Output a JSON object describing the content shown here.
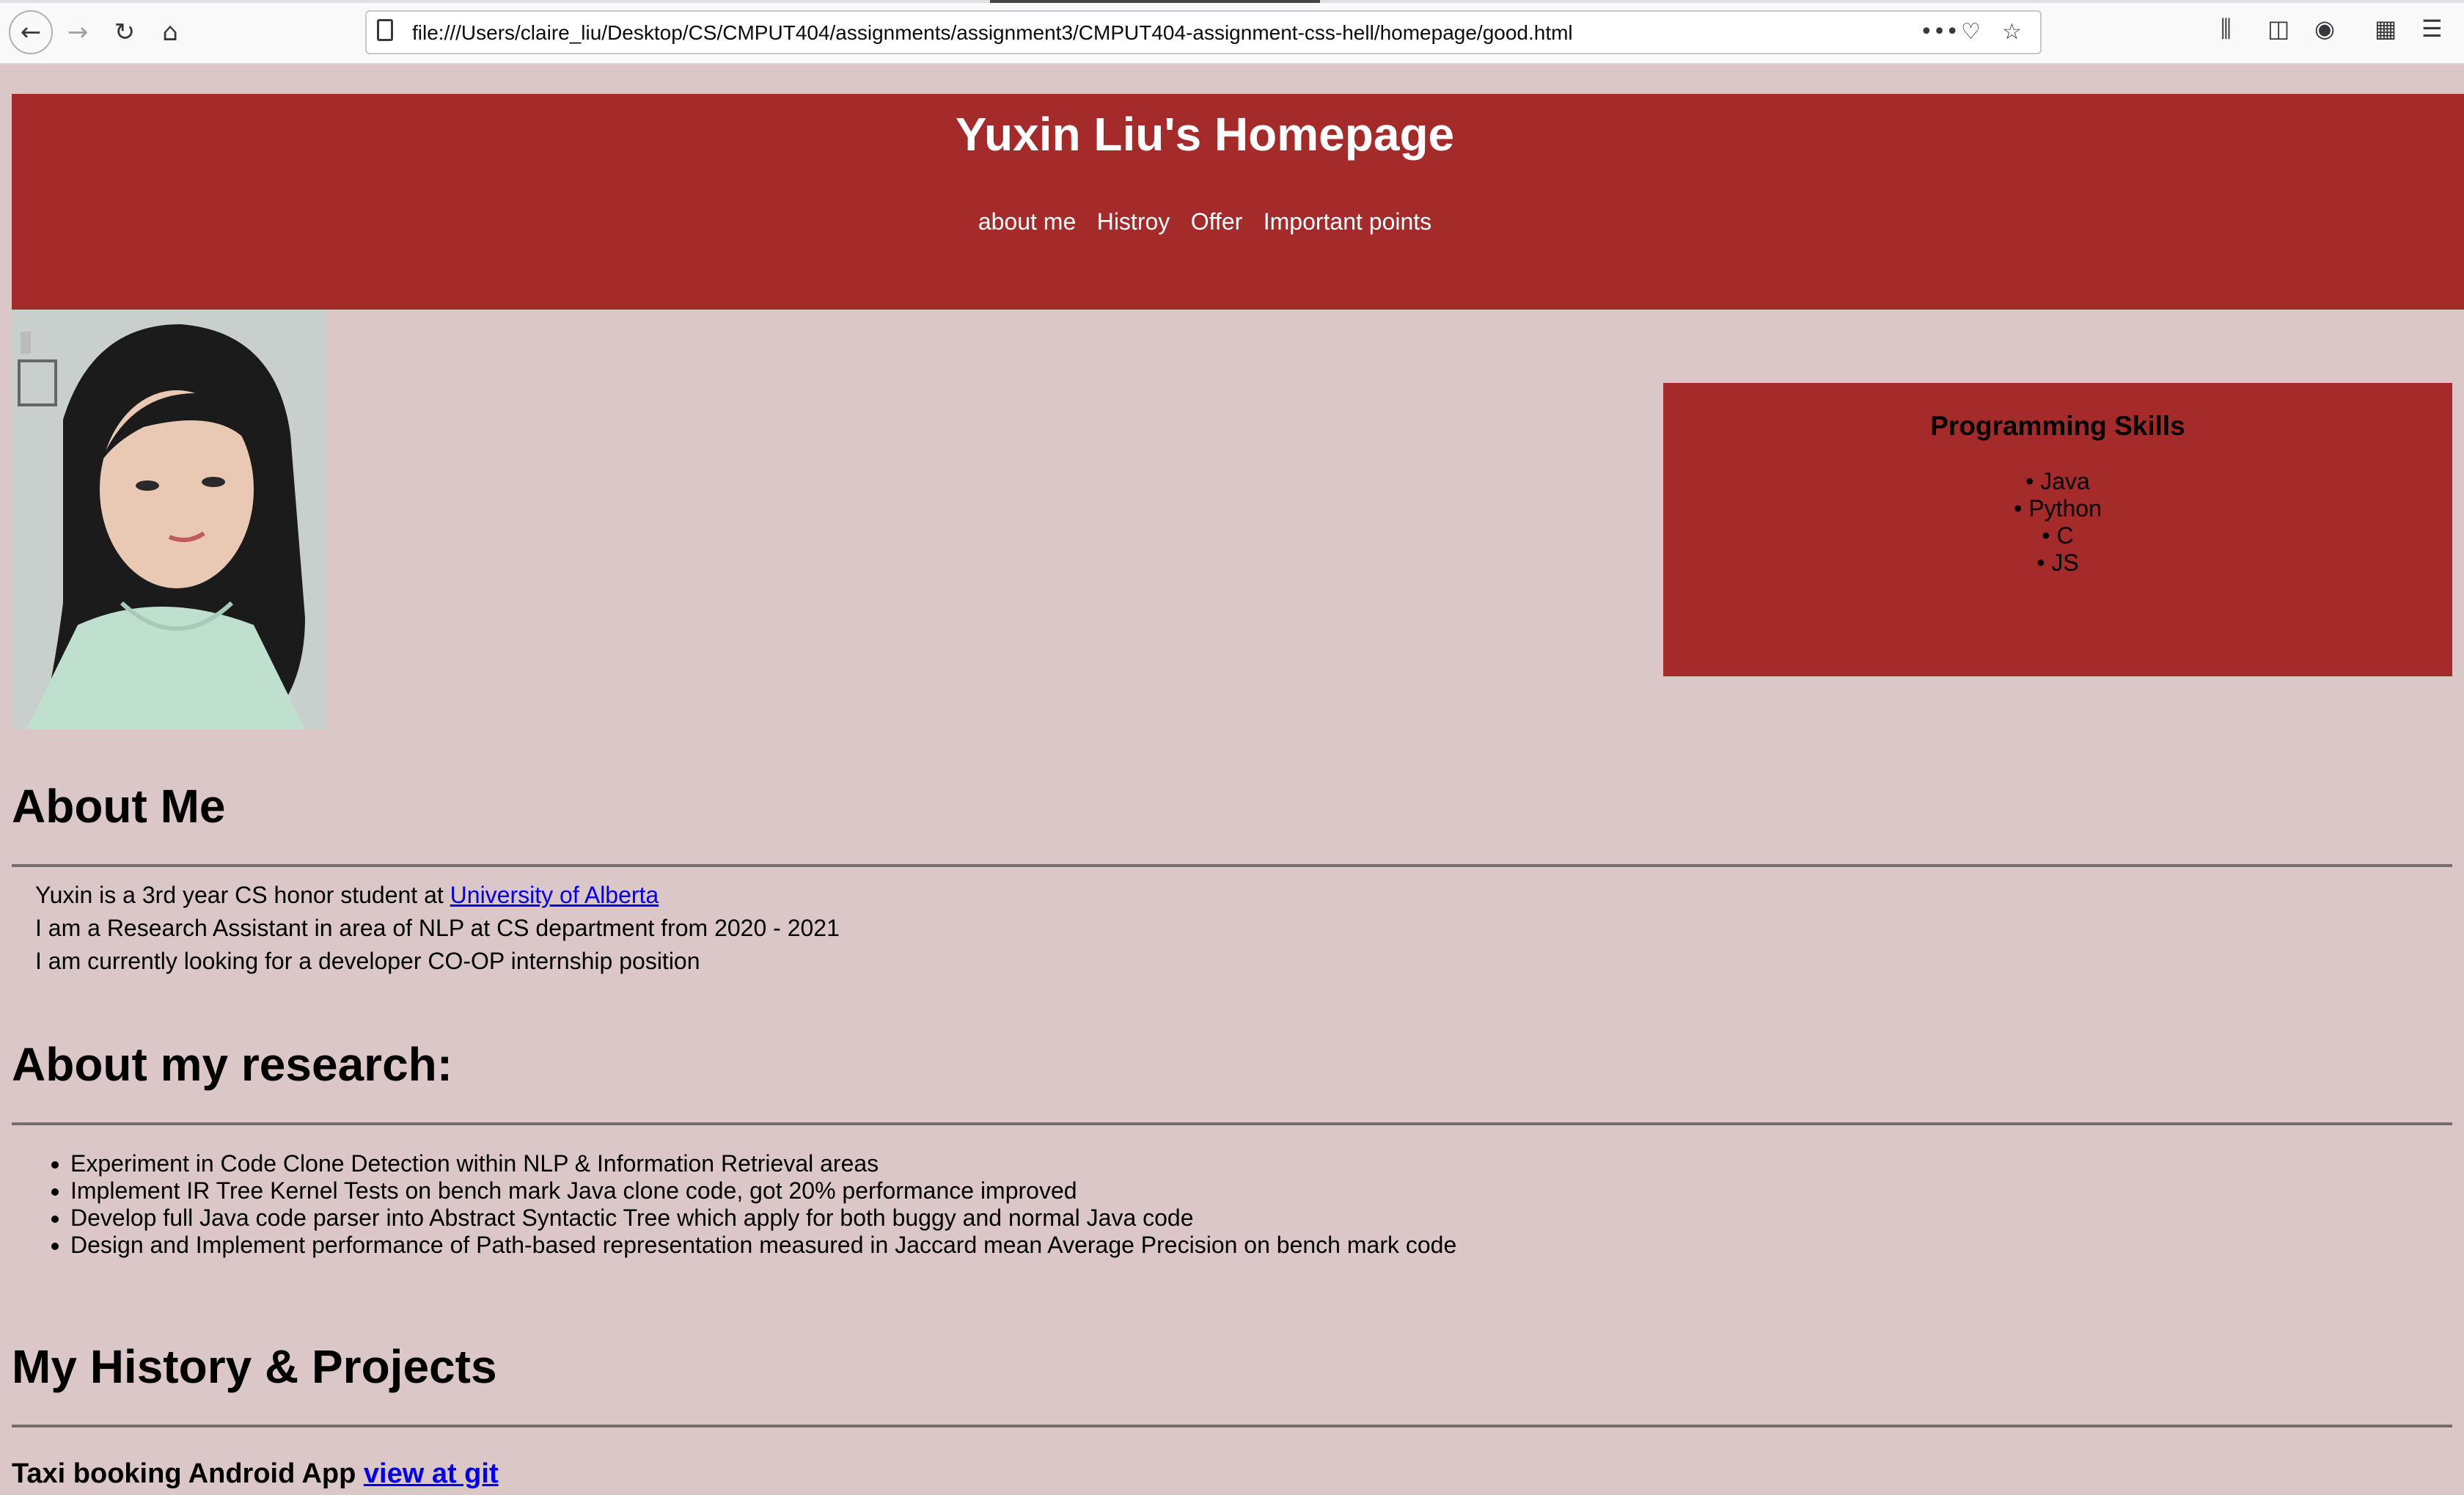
{
  "browser": {
    "url": "file:///Users/claire_liu/Desktop/CS/CMPUT404/assignments/assignment3/CMPUT404-assignment-css-hell/homepage/good.html",
    "icons": [
      "back-arrow-icon",
      "forward-arrow-icon",
      "reload-icon",
      "home-icon",
      "page-icon",
      "more-icon",
      "pocket-icon",
      "bookmark-star-icon",
      "library-icon",
      "sidebar-icon",
      "account-icon",
      "extensions-icon",
      "menu-icon"
    ]
  },
  "header": {
    "title": "Yuxin Liu's Homepage",
    "nav": [
      "about me",
      "Histroy",
      "Offer",
      "Important points"
    ]
  },
  "skills": {
    "title": "Programming Skills",
    "items": [
      "Java",
      "Python",
      "C",
      "JS"
    ]
  },
  "about": {
    "heading": "About Me",
    "line1_prefix": "Yuxin is a 3rd year CS honor student at ",
    "line1_link": "University of Alberta",
    "line2": "I am a Research Assistant in area of NLP at CS department from 2020 - 2021",
    "line3": "I am currently looking for a developer CO-OP internship position"
  },
  "research": {
    "heading": "About my research:",
    "items": [
      "Experiment in Code Clone Detection within NLP & Information Retrieval areas",
      "Implement IR Tree Kernel Tests on bench mark Java clone code, got 20% performance improved",
      "Develop full Java code parser into Abstract Syntactic Tree which apply for both buggy and normal Java code",
      "Design and Implement performance of Path-based representation measured in Jaccard mean Average Precision on bench mark code"
    ]
  },
  "history": {
    "heading": "My History & Projects",
    "project1_title": "Taxi booking Android App",
    "project1_link": "view at git"
  },
  "colors": {
    "page_background": "#dbc7c8",
    "accent": "#a52a2a",
    "link": "#0000ee"
  }
}
